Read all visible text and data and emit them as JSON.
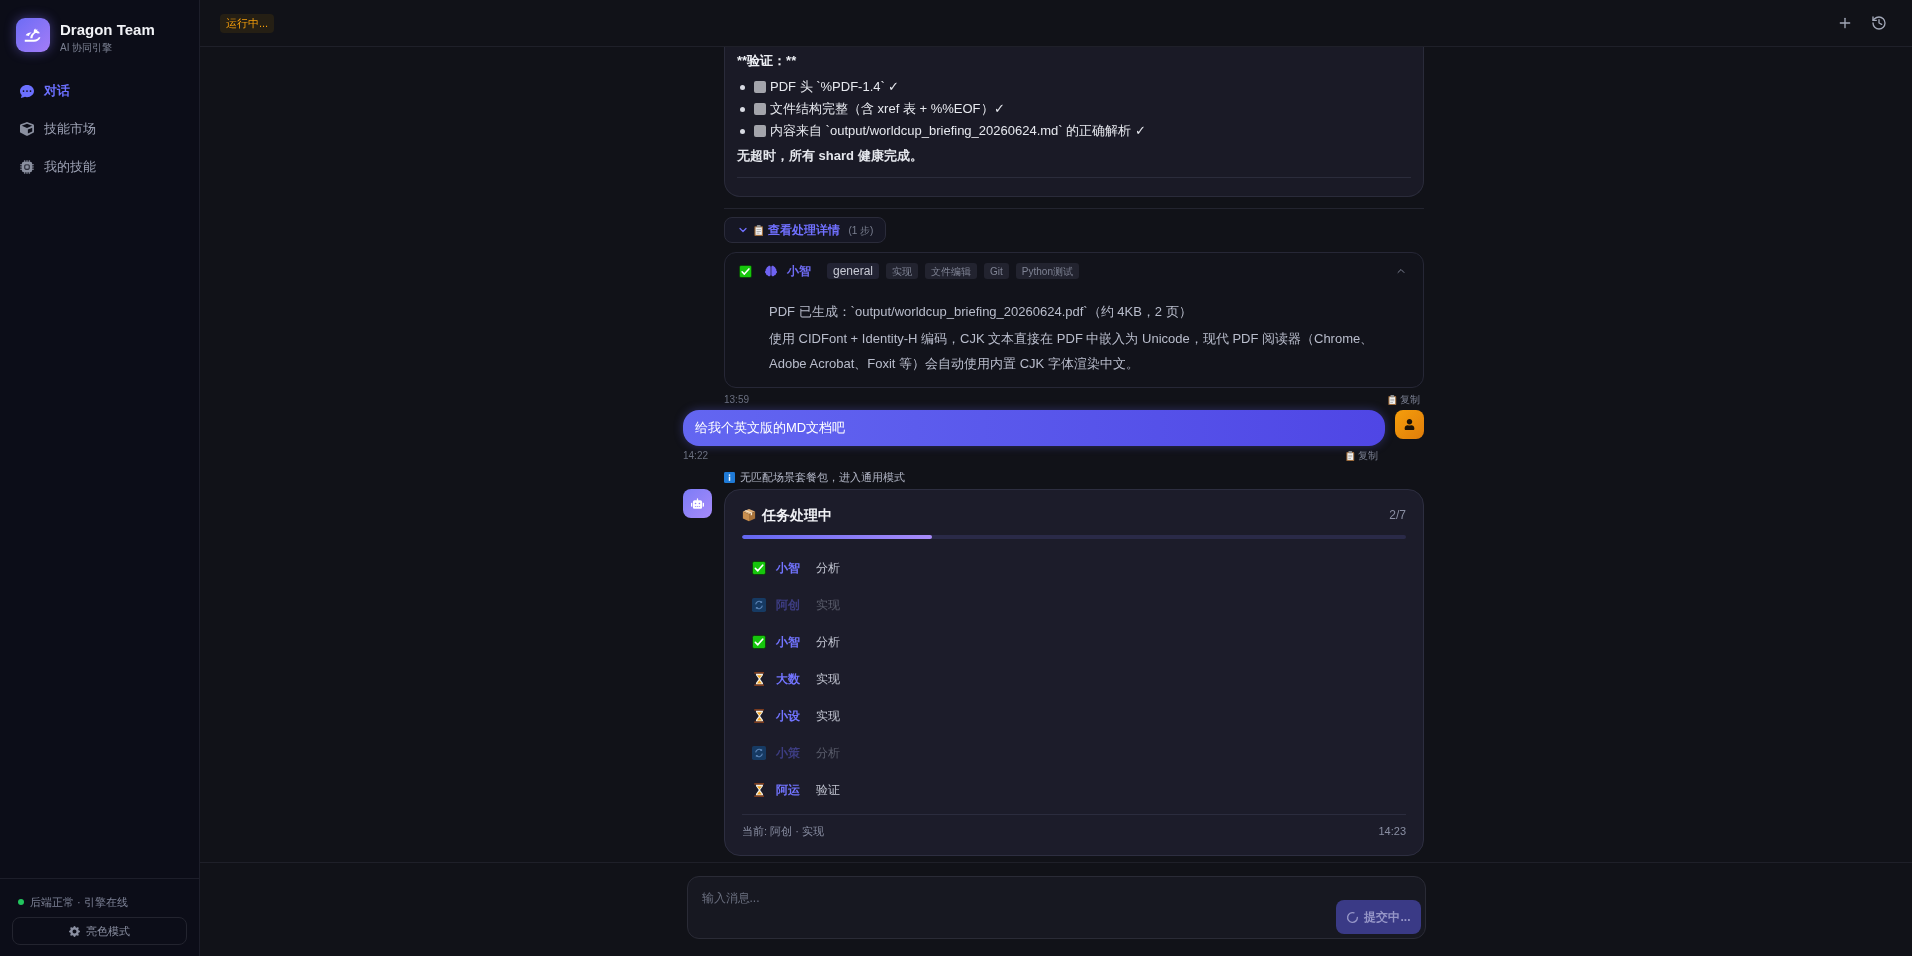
{
  "sidebar": {
    "brand": {
      "title": "Dragon Team",
      "subtitle": "AI 协同引擎"
    },
    "nav": [
      {
        "label": "对话",
        "selected": true
      },
      {
        "label": "技能市场",
        "selected": false
      },
      {
        "label": "我的技能",
        "selected": false
      }
    ],
    "status": {
      "text": "后端正常 · 引擎在线",
      "online": true
    },
    "theme_button": "亮色模式"
  },
  "header": {
    "status_badge": "运行中..."
  },
  "chat": {
    "reply": {
      "heading": "**验证：**",
      "checklist": [
        {
          "text": "PDF 头 `%PDF-1.4` ✓",
          "checked": false
        },
        {
          "text": "文件结构完整（含 xref 表 + %%EOF）✓",
          "checked": false
        },
        {
          "text": "内容来自 `output/worldcup_briefing_20260624.md` 的正确解析 ✓",
          "checked": false
        }
      ],
      "summary": "无超时，所有 shard 健康完成。",
      "details": {
        "label": "查看处理详情",
        "count": "(1 步)",
        "expanded": true,
        "steps": [
          {
            "kind": "done",
            "agent": "小智",
            "tags": [
              {
                "label": "general",
                "kind": "role"
              },
              {
                "label": "实现",
                "kind": "skill"
              },
              {
                "label": "文件编辑",
                "kind": "skill"
              },
              {
                "label": "Git",
                "kind": "skill"
              },
              {
                "label": "Python测试",
                "kind": "skill"
              }
            ],
            "expanded": true,
            "body": [
              "PDF 已生成：`output/worldcup_briefing_20260624.pdf`（约 4KB，2 页）",
              "使用 CIDFont + Identity-H 编码，CJK 文本直接在 PDF 中嵌入为 Unicode，现代 PDF 阅读器（Chrome、Adobe Acrobat、Foxit 等）会自动使用内置 CJK 字体渲染中文。"
            ]
          }
        ]
      },
      "time": "13:59",
      "copy": "复制"
    },
    "user_message": {
      "text": "给我个英文版的MD文档吧",
      "time": "14:22",
      "copy": "复制"
    },
    "notice": "无匹配场景套餐包，进入通用模式",
    "task_card": {
      "title": "任务处理中",
      "progress": "2/7",
      "level": 0.286,
      "tasks": [
        {
          "agent": "小智",
          "action": "分析",
          "kind": "done"
        },
        {
          "agent": "阿创",
          "action": "实现",
          "kind": "running"
        },
        {
          "agent": "小智",
          "action": "分析",
          "kind": "done"
        },
        {
          "agent": "大数",
          "action": "实现",
          "kind": "waiting"
        },
        {
          "agent": "小设",
          "action": "实现",
          "kind": "waiting"
        },
        {
          "agent": "小策",
          "action": "分析",
          "kind": "running"
        },
        {
          "agent": "阿运",
          "action": "验证",
          "kind": "waiting"
        }
      ],
      "current": "当前: 阿创 · 实现",
      "time": "14:23"
    }
  },
  "composer": {
    "placeholder": "输入消息...",
    "submit": {
      "label": "提交中...",
      "busy": true
    }
  }
}
